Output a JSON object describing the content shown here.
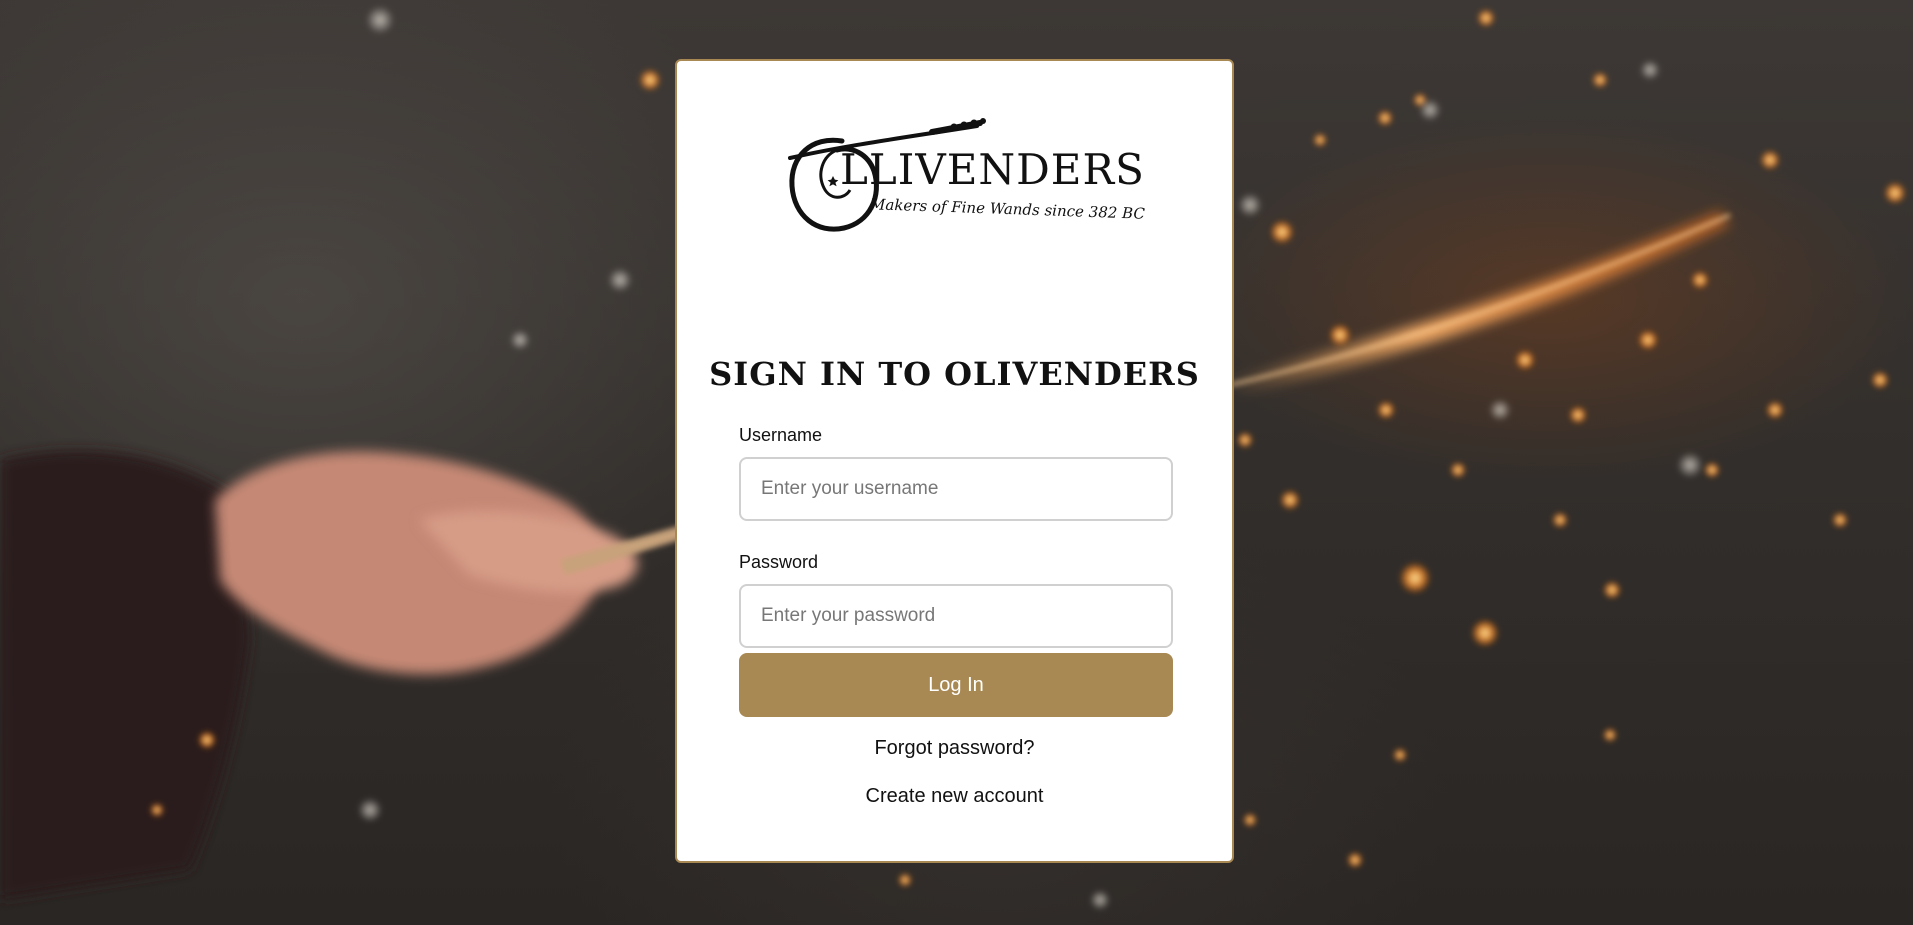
{
  "app": {
    "brand_name": "LLIVENDERS",
    "tagline": "Makers of Fine Wands since 382 BC"
  },
  "login_form": {
    "title": "SIGN IN TO OLIVENDERS",
    "username": {
      "label": "Username",
      "value": "",
      "placeholder": "Enter your username"
    },
    "password": {
      "label": "Password",
      "value": "",
      "placeholder": "Enter your password"
    },
    "submit_label": "Log In",
    "forgot_password_link": "Forgot password?",
    "create_account_link": "Create new account"
  },
  "theme": {
    "accent_color": "#a88953",
    "card_background": "#ffffff",
    "input_border": "#d0d0d0"
  },
  "icons": {
    "logo": "ollivanders-wand-logo-icon",
    "background": "hand-holding-wand-sparks-photo"
  }
}
